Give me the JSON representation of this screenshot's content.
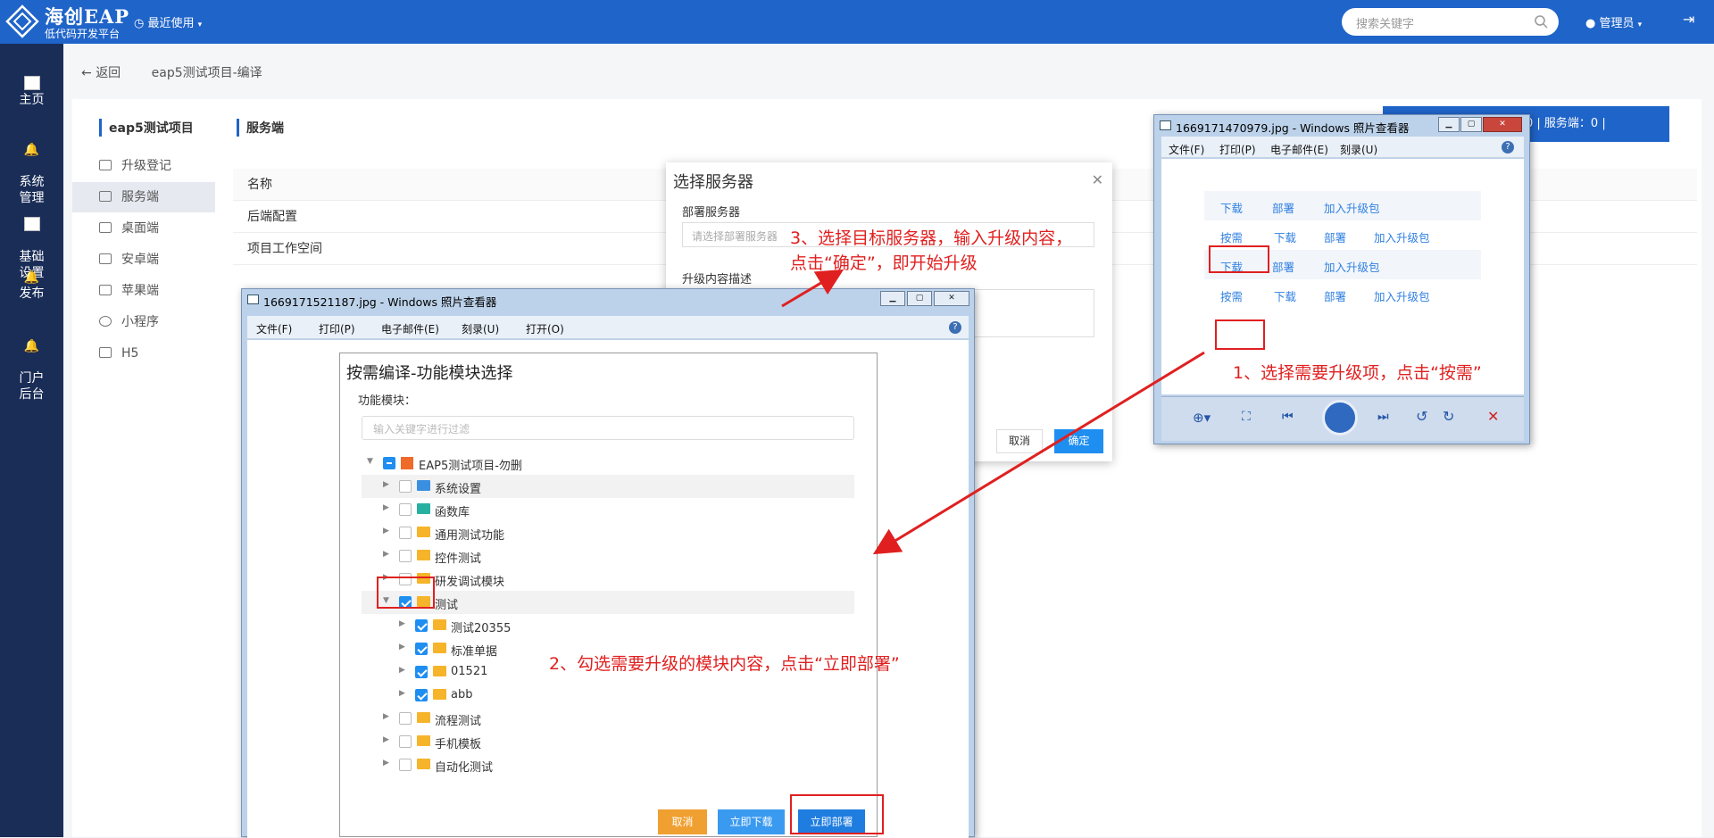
{
  "topbar": {
    "logo_title": "海创EAP",
    "logo_subtitle": "低代码开发平台",
    "recent_label": "最近使用",
    "search_placeholder": "搜索关键字",
    "user_label": "管理员"
  },
  "leftnav": {
    "items": [
      {
        "label": "主页"
      },
      {
        "label": "系统\n管理"
      },
      {
        "label": "基础\n设置"
      },
      {
        "label": "发布"
      },
      {
        "label": "门户\n后台"
      }
    ]
  },
  "breadcrumb": {
    "back": "返回",
    "current": "eap5测试项目-编译"
  },
  "sidebar": {
    "title": "eap5测试项目",
    "items": [
      {
        "label": "升级登记"
      },
      {
        "label": "服务端"
      },
      {
        "label": "桌面端"
      },
      {
        "label": "安卓端"
      },
      {
        "label": "苹果端"
      },
      {
        "label": "小程序"
      },
      {
        "label": "H5"
      }
    ]
  },
  "main": {
    "title": "服务端",
    "column_name": "名称",
    "rows": [
      "后端配置",
      "项目工作空间"
    ],
    "top_button": "0 | 服务端：0 |"
  },
  "dialog": {
    "title": "选择服务器",
    "server_label": "部署服务器",
    "server_placeholder": "请选择部署服务器",
    "desc_label": "升级内容描述",
    "cancel": "取消",
    "ok": "确定"
  },
  "viewer1": {
    "title": "1669171470979.jpg - Windows 照片查看器",
    "menu": [
      "文件(F)",
      "打印(P)",
      "电子邮件(E)",
      "刻录(U)"
    ],
    "rows": [
      {
        "actions": [
          "下载",
          "部署",
          "加入升级包"
        ]
      },
      {
        "actions": [
          "按需",
          "下载",
          "部署",
          "加入升级包"
        ]
      },
      {
        "actions": [
          "下载",
          "部署",
          "加入升级包"
        ]
      },
      {
        "actions": [
          "按需",
          "下载",
          "部署",
          "加入升级包"
        ]
      }
    ],
    "annotation": "1、选择需要升级项，点击“按需”"
  },
  "viewer2": {
    "title": "1669171521187.jpg - Windows 照片查看器",
    "menu": [
      "文件(F)",
      "打印(P)",
      "电子邮件(E)",
      "刻录(U)",
      "打开(O)"
    ],
    "panel_title": "按需编译-功能模块选择",
    "module_label": "功能模块：",
    "filter_placeholder": "输入关键字进行过滤",
    "tree": [
      "EAP5测试项目-勿删",
      "系统设置",
      "函数库",
      "通用测试功能",
      "控件测试",
      "研发调试模块",
      "测试",
      "测试20355",
      "标准单据",
      "01521",
      "abb",
      "流程测试",
      "手机模板",
      "自动化测试"
    ],
    "btn_cancel": "取消",
    "btn_download": "立即下载",
    "btn_deploy": "立即部署",
    "annotation": "2、勾选需要升级的模块内容，点击“立即部署”"
  },
  "annotation3": {
    "line1": "3、选择目标服务器，输入升级内容，",
    "line2": "点击“确定”，即开始升级"
  },
  "colors": {
    "primary": "#1f64c9",
    "nav": "#1a2d57",
    "annotation": "#e02020"
  }
}
